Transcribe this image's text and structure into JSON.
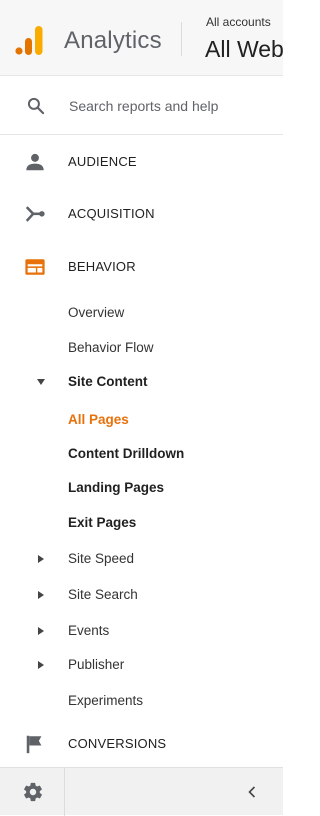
{
  "header": {
    "app_title": "Analytics",
    "account_crumb": "All accounts",
    "view_name": "All Web",
    "logo_colors": [
      "#f9ab00",
      "#e37400",
      "#e8710a"
    ]
  },
  "search": {
    "label": "Search reports and help",
    "icon": "search-icon"
  },
  "sections": {
    "audience": {
      "label": "AUDIENCE",
      "icon": "person-icon"
    },
    "acquisition": {
      "label": "ACQUISITION",
      "icon": "acquisition-icon"
    },
    "behavior": {
      "label": "BEHAVIOR",
      "icon": "behavior-icon",
      "color": "#e8710a"
    },
    "conversions": {
      "label": "CONVERSIONS",
      "icon": "flag-icon"
    }
  },
  "behavior_items": [
    {
      "label": "Overview"
    },
    {
      "label": "Behavior Flow"
    },
    {
      "label": "Site Content",
      "expanded": true
    },
    {
      "label": "All Pages",
      "active": true
    },
    {
      "label": "Content Drilldown"
    },
    {
      "label": "Landing Pages"
    },
    {
      "label": "Exit Pages"
    },
    {
      "label": "Site Speed",
      "expanded": false
    },
    {
      "label": "Site Search",
      "expanded": false
    },
    {
      "label": "Events",
      "expanded": false
    },
    {
      "label": "Publisher",
      "expanded": false
    },
    {
      "label": "Experiments"
    }
  ],
  "footer": {
    "settings_icon": "gear-icon",
    "collapse_icon": "chevron-left-icon"
  },
  "colors": {
    "accent": "#e8710a",
    "icon_gray": "#5f6368"
  }
}
